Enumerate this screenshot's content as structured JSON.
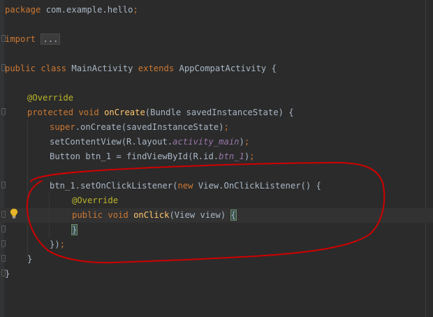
{
  "code_lines": [
    {
      "id": "package",
      "parts": [
        {
          "t": "package",
          "c": "kw"
        },
        {
          "t": " com.example.hello"
        },
        {
          "t": ";",
          "c": "kw"
        }
      ]
    },
    {
      "id": "import",
      "parts": [
        {
          "t": "import",
          "c": "kw"
        },
        {
          "t": " "
        },
        {
          "t": "...",
          "c": "fold-box"
        }
      ]
    },
    {
      "id": "class-decl",
      "parts": [
        {
          "t": "public",
          "c": "kw"
        },
        {
          "t": " "
        },
        {
          "t": "class",
          "c": "kw"
        },
        {
          "t": " MainActivity "
        },
        {
          "t": "extends",
          "c": "kw"
        },
        {
          "t": " AppCompatActivity {"
        }
      ]
    },
    {
      "id": "override-1",
      "parts": [
        {
          "t": "@Override",
          "c": "ann"
        }
      ]
    },
    {
      "id": "oncreate-decl",
      "parts": [
        {
          "t": "protected",
          "c": "kw"
        },
        {
          "t": " "
        },
        {
          "t": "void",
          "c": "kw"
        },
        {
          "t": " "
        },
        {
          "t": "onCreate",
          "c": "fn"
        },
        {
          "t": "(Bundle savedInstanceState) {"
        }
      ]
    },
    {
      "id": "super-call",
      "parts": [
        {
          "t": "super",
          "c": "kw"
        },
        {
          "t": ".onCreate(savedInstanceState)"
        },
        {
          "t": ";",
          "c": "kw"
        }
      ]
    },
    {
      "id": "set-content-view",
      "parts": [
        {
          "t": "setContentView(R.layout."
        },
        {
          "t": "activity_main",
          "c": "ital"
        },
        {
          "t": ")"
        },
        {
          "t": ";",
          "c": "kw"
        }
      ]
    },
    {
      "id": "button-decl",
      "parts": [
        {
          "t": "Button btn_1 = findViewById(R.id."
        },
        {
          "t": "btn_1",
          "c": "ital"
        },
        {
          "t": ")"
        },
        {
          "t": ";",
          "c": "kw"
        }
      ]
    },
    {
      "id": "set-listener",
      "parts": [
        {
          "t": "btn_1.setOnClickListener("
        },
        {
          "t": "new",
          "c": "kw"
        },
        {
          "t": " View.OnClickListener() {"
        }
      ]
    },
    {
      "id": "override-2",
      "parts": [
        {
          "t": "@Override",
          "c": "ann"
        }
      ]
    },
    {
      "id": "onclick-decl",
      "parts": [
        {
          "t": "public",
          "c": "kw"
        },
        {
          "t": " "
        },
        {
          "t": "void",
          "c": "kw"
        },
        {
          "t": " "
        },
        {
          "t": "onClick",
          "c": "fn"
        },
        {
          "t": "(View view) "
        },
        {
          "t": "{",
          "c": "caret-brace"
        }
      ]
    },
    {
      "id": "onclick-close",
      "parts": [
        {
          "t": "}",
          "c": "caret-brace"
        }
      ]
    },
    {
      "id": "listener-close",
      "parts": [
        {
          "t": "})"
        },
        {
          "t": ";",
          "c": "kw"
        }
      ]
    },
    {
      "id": "oncreate-close",
      "parts": [
        {
          "t": "}"
        }
      ]
    },
    {
      "id": "class-close",
      "parts": [
        {
          "t": "}"
        }
      ]
    }
  ],
  "colors": {
    "background": "#2b2b2b",
    "keyword": "#cc7832",
    "annotation": "#bbb529",
    "method": "#ffc66d",
    "field": "#9876aa",
    "plain": "#a9b7c6",
    "freehand_circle": "#d10000"
  },
  "icons": {
    "intention_bulb": "lightbulb-icon",
    "fold_markers": "fold-marker-icon"
  }
}
